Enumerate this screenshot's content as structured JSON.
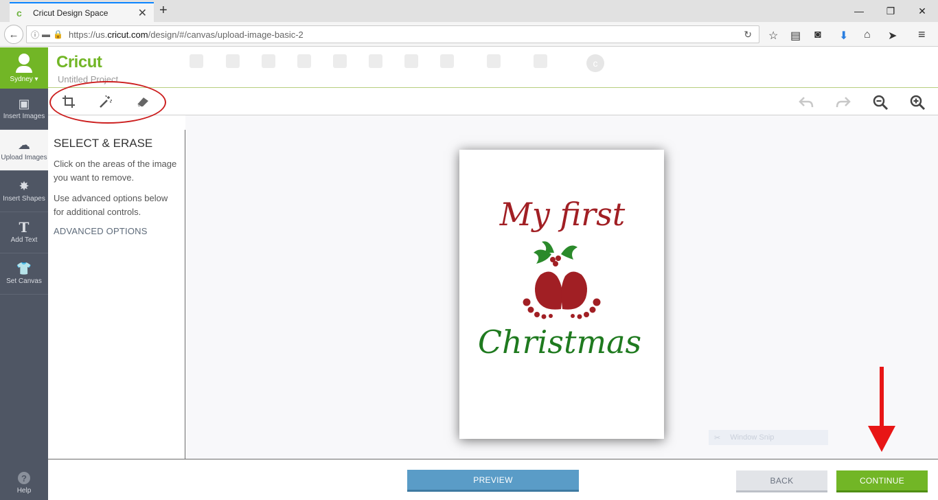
{
  "browser": {
    "tab_title": "Cricut Design Space",
    "url_prefix": "https://us.",
    "url_host": "cricut.com",
    "url_path": "/design/#/canvas/upload-image-basic-2"
  },
  "sidebar": {
    "user_name": "Sydney",
    "items": [
      {
        "label": "Insert Images",
        "icon": "image-icon"
      },
      {
        "label": "Upload Images",
        "icon": "cloud-upload-icon"
      },
      {
        "label": "Insert Shapes",
        "icon": "shapes-icon"
      },
      {
        "label": "Add Text",
        "icon": "text-icon"
      },
      {
        "label": "Set Canvas",
        "icon": "tshirt-icon"
      }
    ],
    "help_label": "Help"
  },
  "header": {
    "logo": "Cricut",
    "project_title": "Untitled Project"
  },
  "panel": {
    "title": "SELECT & ERASE",
    "instruction_1": "Click on the areas of the image you want to remove.",
    "instruction_2": "Use advanced options below for additional controls.",
    "advanced_link": "ADVANCED OPTIONS"
  },
  "artwork": {
    "line_1": "My first",
    "line_2": "Christmas",
    "colors": {
      "red": "#a11f24",
      "green": "#1f7a1f"
    }
  },
  "footer": {
    "preview_label": "PREVIEW",
    "back_label": "BACK",
    "continue_label": "CONTINUE"
  },
  "overlay": {
    "window_snip": "Window Snip"
  },
  "colors": {
    "brand_green": "#72b626",
    "sidebar": "#4f5664",
    "preview_blue": "#5a9cc7",
    "annotation_red": "#cc1f1f"
  }
}
